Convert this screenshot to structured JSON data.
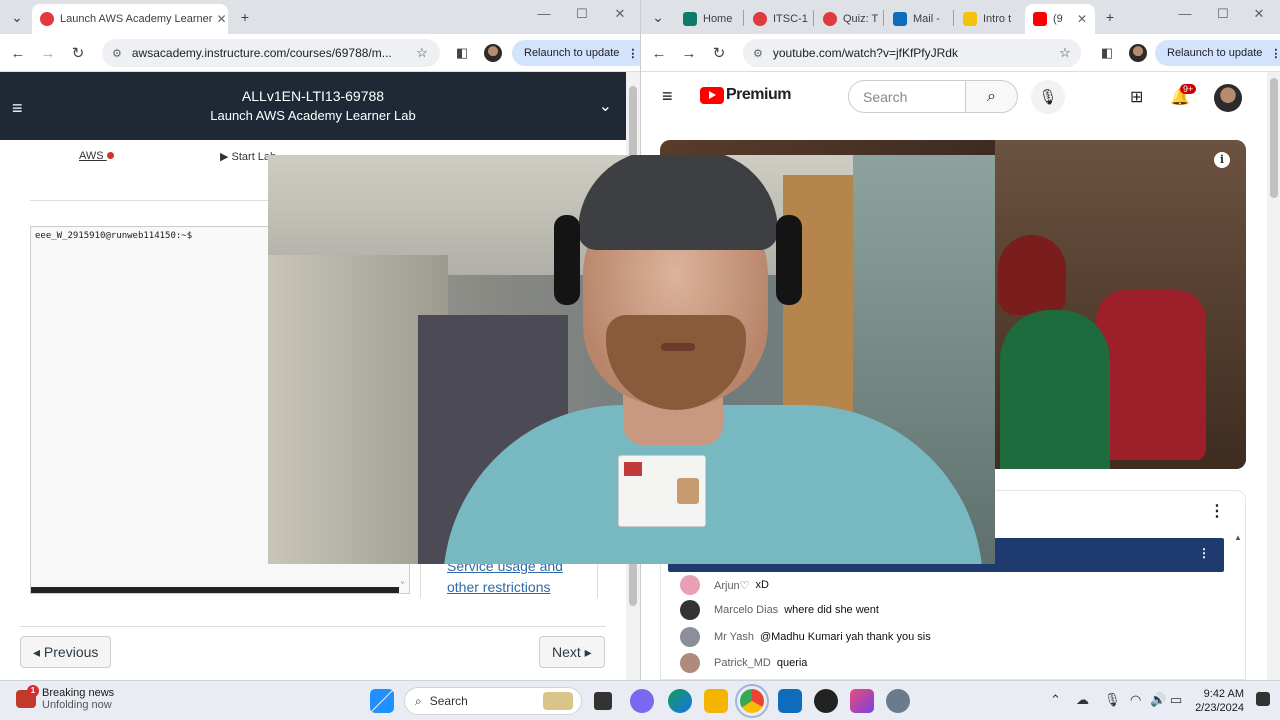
{
  "left_window": {
    "tab_title": "Launch AWS Academy Learner",
    "url": "awsacademy.instructure.com/courses/69788/m...",
    "relaunch": "Relaunch to update",
    "header_line1": "ALLv1EN-LTI13-69788",
    "header_line2": "Launch AWS Academy Learner Lab",
    "aws_label": "AWS",
    "start_lab": "▶ Start Lab",
    "terminal_prompt": "eee_W_2915910@runweb114150:~$",
    "link1": "Service usage and",
    "link2": "other restrictions",
    "prev_button": "◂ Previous",
    "next_button": "Next ▸"
  },
  "right_window": {
    "tabs": [
      "Home",
      "ITSC-1",
      "Quiz: T",
      "Mail - ",
      "Intro t",
      "(9"
    ],
    "url": "youtube.com/watch?v=jfKfPfyJRdk",
    "relaunch": "Relaunch to update",
    "logo_text": "Premium",
    "search_placeholder": "Search",
    "notif_badge": "9+",
    "chat": [
      {
        "name": "Arjun♡",
        "msg": "xD",
        "color": "#e8a0b4"
      },
      {
        "name": "Marcelo Dias",
        "msg": "where did she went",
        "color": "#333333"
      },
      {
        "name": "Mr Yash",
        "msg": "@Madhu Kumari yah thank you sis",
        "color": "#8a8f99"
      },
      {
        "name": "Patrick_MD",
        "msg": "queria",
        "color": "#b08a7a"
      }
    ]
  },
  "taskbar": {
    "news_title": "Breaking news",
    "news_sub": "Unfolding now",
    "news_badge": "1",
    "search": "Search",
    "time": "9:42 AM",
    "date": "2/23/2024"
  },
  "colors": {
    "canvas_header": "#1e2935",
    "yt_red": "#ff0000",
    "relaunch_bg": "#d3e3fd"
  }
}
